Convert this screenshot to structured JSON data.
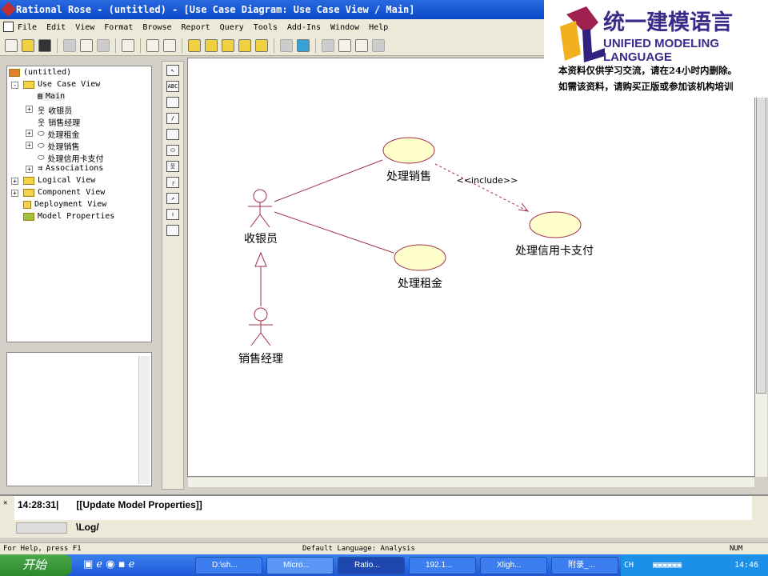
{
  "title": "Rational Rose - (untitled) - [Use Case Diagram: Use Case View / Main]",
  "menu": [
    "File",
    "Edit",
    "View",
    "Format",
    "Browse",
    "Report",
    "Query",
    "Tools",
    "Add-Ins",
    "Window",
    "Help"
  ],
  "browser": {
    "root": "(untitled)",
    "items": [
      "Use Case View",
      "Main",
      "收银员",
      "销售经理",
      "处理租金",
      "处理销售",
      "处理信用卡支付",
      "Associations",
      "Logical View",
      "Component View",
      "Deployment View",
      "Model Properties"
    ]
  },
  "toolbox": {
    "text_tool": "ABC"
  },
  "diagram": {
    "actors": [
      "收银员",
      "销售经理"
    ],
    "use_cases": [
      "处理销售",
      "处理租金",
      "处理信用卡支付"
    ],
    "include_label": "<<include>>",
    "line_color": "#a0304a",
    "usecase_fill": "#ffffcc"
  },
  "log": {
    "time": "14:28:31|",
    "message": "[[Update Model Properties]]",
    "tab": "\\Log/"
  },
  "status": {
    "help": "For Help, press F1",
    "language": "Default Language: Analysis",
    "num": "NUM"
  },
  "taskbar": {
    "start": "开始",
    "tasks": [
      "D:\\sh...",
      "Micro...",
      "Ratio...",
      "192.1...",
      "Xligh...",
      "附录_..."
    ],
    "lang": "CH",
    "clock": "14:46"
  },
  "watermark": {
    "title": "统一建模语言",
    "subtitle": "UNIFIED MODELING LANGUAGE",
    "line1": "本资料仅供学习交流，请在24小时内删除。",
    "line2": "如需该资料，请购买正版或参加该机构培训"
  }
}
